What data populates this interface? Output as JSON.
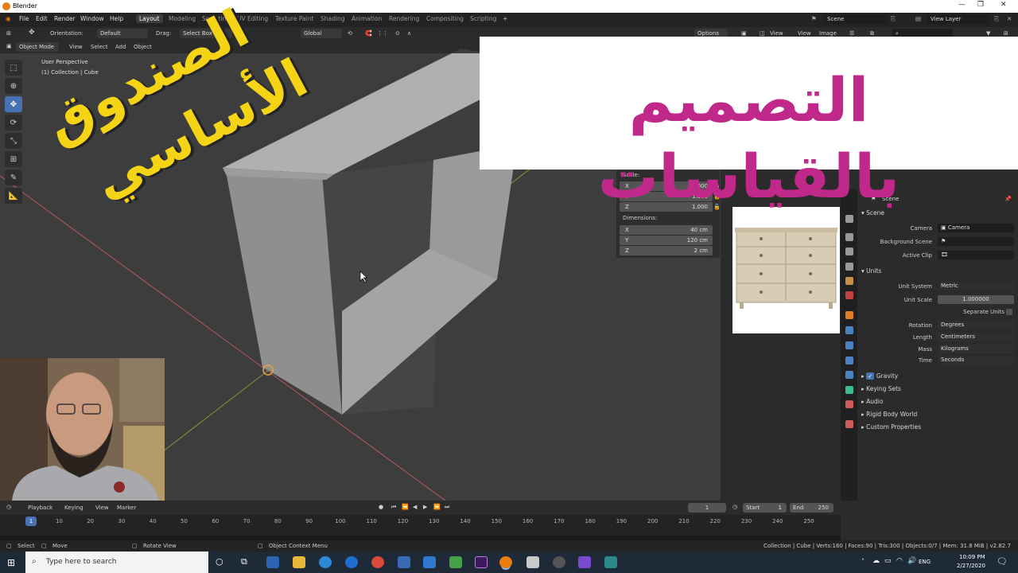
{
  "window": {
    "title": "Blender"
  },
  "menu": [
    "File",
    "Edit",
    "Render",
    "Window",
    "Help"
  ],
  "workspaces": [
    "Layout",
    "Modeling",
    "Sculpting",
    "UV Editing",
    "Texture Paint",
    "Shading",
    "Animation",
    "Rendering",
    "Compositing",
    "Scripting"
  ],
  "scene_field": "Scene",
  "view_layer_field": "View Layer",
  "header": {
    "orientation_label": "Orientation:",
    "orientation_value": "Default",
    "drag_label": "Drag:",
    "drag_value": "Select Box",
    "transform": "Global",
    "options": "Options",
    "view": "View",
    "view2": "View",
    "image": "Image"
  },
  "viewport": {
    "mode": "Object Mode",
    "menus": [
      "View",
      "Select",
      "Add",
      "Object"
    ],
    "info1": "User Perspective",
    "info2": "(1) Collection | Cube"
  },
  "npanel": {
    "scale_label": "Scale:",
    "scale": [
      {
        "axis": "X",
        "value": "1.000"
      },
      {
        "axis": "Y",
        "value": "1.000"
      },
      {
        "axis": "Z",
        "value": "1.000"
      }
    ],
    "dim_label": "Dimensions:",
    "dims": [
      {
        "axis": "X",
        "value": "40 cm"
      },
      {
        "axis": "Y",
        "value": "120 cm"
      },
      {
        "axis": "Z",
        "value": "2 cm"
      }
    ]
  },
  "banner": {
    "text": "التصميم بالقياسات"
  },
  "overlay": {
    "line1": "الصندوق",
    "line2": "الأساسي"
  },
  "properties": {
    "header": "Scene",
    "section_scene": "Scene",
    "camera_label": "Camera",
    "camera_value": "Camera",
    "bg_label": "Background Scene",
    "clip_label": "Active Clip",
    "units_section": "Units",
    "unit_system_label": "Unit System",
    "unit_system": "Metric",
    "unit_scale_label": "Unit Scale",
    "unit_scale": "1.000000",
    "separate_units": "Separate Units",
    "rotation_label": "Rotation",
    "rotation": "Degrees",
    "length_label": "Length",
    "length": "Centimeters",
    "mass_label": "Mass",
    "mass": "Kilograms",
    "time_label": "Time",
    "time": "Seconds",
    "gravity": "Gravity",
    "keying_sets": "Keying Sets",
    "audio": "Audio",
    "rigid_body": "Rigid Body World",
    "custom_props": "Custom Properties"
  },
  "timeline": {
    "menus": [
      "Playback",
      "Keying",
      "View",
      "Marker"
    ],
    "current": "1",
    "start_label": "Start",
    "start": "1",
    "end_label": "End",
    "end": "250",
    "ticks": [
      "1",
      "10",
      "20",
      "30",
      "40",
      "50",
      "60",
      "70",
      "80",
      "90",
      "100",
      "110",
      "120",
      "130",
      "140",
      "150",
      "160",
      "170",
      "180",
      "190",
      "200",
      "210",
      "220",
      "230",
      "240",
      "250"
    ]
  },
  "status": {
    "select": "Select",
    "move": "Move",
    "rotate": "Rotate View",
    "context": "Object Context Menu",
    "stats": "Collection | Cube | Verts:160 | Faces:90 | Tris:300 | Objects:0/7 | Mem: 31.8 MiB | v2.82.7"
  },
  "taskbar": {
    "search": "Type here to search",
    "lang": "ENG",
    "time": "10:09 PM",
    "date": "2/27/2020"
  }
}
